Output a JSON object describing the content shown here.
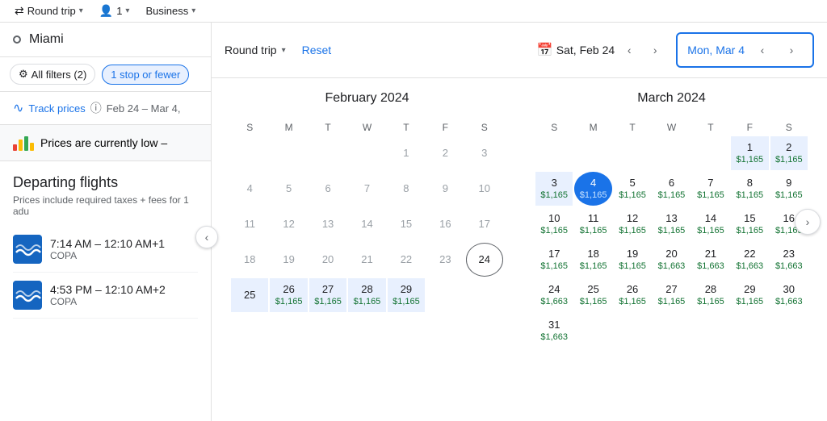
{
  "topBar": {
    "tripType": "Round trip",
    "passengers": "1",
    "cabinClass": "Business",
    "tripTypeChevron": "▾",
    "passengersChevron": "▾",
    "cabinChevron": "▾"
  },
  "leftPanel": {
    "searchCity": "Miami",
    "filters": {
      "allFilters": "All filters (2)",
      "stops": "1 stop or fewer"
    },
    "trackPrices": {
      "label": "Track prices",
      "dates": "Feb 24 – Mar 4,"
    },
    "pricesLow": "Prices are currently low –",
    "departingTitle": "Departing flights",
    "departingSub": "Prices include required taxes + fees for 1 adu",
    "flights": [
      {
        "time": "7:14 AM – 12:10 AM+1",
        "airline": "COPA"
      },
      {
        "time": "4:53 PM – 12:10 AM+2",
        "airline": "COPA"
      }
    ]
  },
  "calendarPanel": {
    "tripType": "Round trip",
    "resetLabel": "Reset",
    "departureDateLabel": "Sat, Feb 24",
    "returnDateLabel": "Mon, Mar 4",
    "calendarIcon": "📅",
    "february": {
      "title": "February 2024",
      "headers": [
        "S",
        "M",
        "T",
        "W",
        "T",
        "F",
        "S"
      ],
      "weeks": [
        [
          {
            "day": "",
            "price": "",
            "type": "empty"
          },
          {
            "day": "",
            "price": "",
            "type": "empty"
          },
          {
            "day": "",
            "price": "",
            "type": "empty"
          },
          {
            "day": "",
            "price": "",
            "type": "empty"
          },
          {
            "day": "1",
            "price": "",
            "type": "greyed"
          },
          {
            "day": "2",
            "price": "",
            "type": "greyed"
          },
          {
            "day": "3",
            "price": "",
            "type": "greyed"
          }
        ],
        [
          {
            "day": "4",
            "price": "",
            "type": "greyed"
          },
          {
            "day": "5",
            "price": "",
            "type": "greyed"
          },
          {
            "day": "6",
            "price": "",
            "type": "greyed"
          },
          {
            "day": "7",
            "price": "",
            "type": "greyed"
          },
          {
            "day": "8",
            "price": "",
            "type": "greyed"
          },
          {
            "day": "9",
            "price": "",
            "type": "greyed"
          },
          {
            "day": "10",
            "price": "",
            "type": "greyed"
          }
        ],
        [
          {
            "day": "11",
            "price": "",
            "type": "greyed"
          },
          {
            "day": "12",
            "price": "",
            "type": "greyed"
          },
          {
            "day": "13",
            "price": "",
            "type": "greyed"
          },
          {
            "day": "14",
            "price": "",
            "type": "greyed"
          },
          {
            "day": "15",
            "price": "",
            "type": "greyed"
          },
          {
            "day": "16",
            "price": "",
            "type": "greyed"
          },
          {
            "day": "17",
            "price": "",
            "type": "greyed"
          }
        ],
        [
          {
            "day": "18",
            "price": "",
            "type": "greyed"
          },
          {
            "day": "19",
            "price": "",
            "type": "greyed"
          },
          {
            "day": "20",
            "price": "",
            "type": "greyed"
          },
          {
            "day": "21",
            "price": "",
            "type": "greyed"
          },
          {
            "day": "22",
            "price": "",
            "type": "greyed"
          },
          {
            "day": "23",
            "price": "",
            "type": "greyed"
          },
          {
            "day": "24",
            "price": "",
            "type": "today-circle"
          }
        ],
        [
          {
            "day": "25",
            "price": "",
            "type": "in-range"
          },
          {
            "day": "26",
            "price": "$1,165",
            "type": "in-range"
          },
          {
            "day": "27",
            "price": "$1,165",
            "type": "in-range"
          },
          {
            "day": "28",
            "price": "$1,165",
            "type": "in-range"
          },
          {
            "day": "29",
            "price": "$1,165",
            "type": "in-range"
          },
          {
            "day": "",
            "price": "",
            "type": "empty"
          },
          {
            "day": "",
            "price": "",
            "type": "empty"
          }
        ]
      ]
    },
    "march": {
      "title": "March 2024",
      "headers": [
        "S",
        "M",
        "T",
        "W",
        "T",
        "F",
        "S"
      ],
      "weeks": [
        [
          {
            "day": "",
            "price": "",
            "type": "empty"
          },
          {
            "day": "",
            "price": "",
            "type": "empty"
          },
          {
            "day": "",
            "price": "",
            "type": "empty"
          },
          {
            "day": "",
            "price": "",
            "type": "empty"
          },
          {
            "day": "",
            "price": "",
            "type": "empty"
          },
          {
            "day": "1",
            "price": "$1,165",
            "type": "in-range"
          },
          {
            "day": "2",
            "price": "$1,165",
            "type": "in-range"
          }
        ],
        [
          {
            "day": "3",
            "price": "$1,165",
            "type": "in-range"
          },
          {
            "day": "4",
            "price": "$1,165",
            "type": "selected"
          },
          {
            "day": "5",
            "price": "$1,165",
            "type": "normal"
          },
          {
            "day": "6",
            "price": "$1,165",
            "type": "normal"
          },
          {
            "day": "7",
            "price": "$1,165",
            "type": "normal"
          },
          {
            "day": "8",
            "price": "$1,165",
            "type": "normal"
          },
          {
            "day": "9",
            "price": "$1,165",
            "type": "normal"
          }
        ],
        [
          {
            "day": "10",
            "price": "$1,165",
            "type": "normal"
          },
          {
            "day": "11",
            "price": "$1,165",
            "type": "normal"
          },
          {
            "day": "12",
            "price": "$1,165",
            "type": "normal"
          },
          {
            "day": "13",
            "price": "$1,165",
            "type": "normal"
          },
          {
            "day": "14",
            "price": "$1,165",
            "type": "normal"
          },
          {
            "day": "15",
            "price": "$1,165",
            "type": "normal"
          },
          {
            "day": "16",
            "price": "$1,165",
            "type": "normal"
          }
        ],
        [
          {
            "day": "17",
            "price": "$1,165",
            "type": "normal"
          },
          {
            "day": "18",
            "price": "$1,165",
            "type": "normal"
          },
          {
            "day": "19",
            "price": "$1,165",
            "type": "normal"
          },
          {
            "day": "20",
            "price": "$1,663",
            "type": "normal"
          },
          {
            "day": "21",
            "price": "$1,663",
            "type": "normal"
          },
          {
            "day": "22",
            "price": "$1,663",
            "type": "normal"
          },
          {
            "day": "23",
            "price": "$1,663",
            "type": "normal"
          }
        ],
        [
          {
            "day": "24",
            "price": "$1,663",
            "type": "normal"
          },
          {
            "day": "25",
            "price": "$1,165",
            "type": "normal"
          },
          {
            "day": "26",
            "price": "$1,165",
            "type": "normal"
          },
          {
            "day": "27",
            "price": "$1,165",
            "type": "normal"
          },
          {
            "day": "28",
            "price": "$1,165",
            "type": "normal"
          },
          {
            "day": "29",
            "price": "$1,165",
            "type": "normal"
          },
          {
            "day": "30",
            "price": "$1,663",
            "type": "normal"
          }
        ],
        [
          {
            "day": "31",
            "price": "$1,663",
            "type": "normal"
          },
          {
            "day": "",
            "price": "",
            "type": "empty"
          },
          {
            "day": "",
            "price": "",
            "type": "empty"
          },
          {
            "day": "",
            "price": "",
            "type": "empty"
          },
          {
            "day": "",
            "price": "",
            "type": "empty"
          },
          {
            "day": "",
            "price": "",
            "type": "empty"
          },
          {
            "day": "",
            "price": "",
            "type": "empty"
          }
        ]
      ]
    }
  },
  "icons": {
    "chevronLeft": "‹",
    "chevronRight": "›",
    "chevronDown": "▾",
    "collapse": "‹",
    "scrollRight": "›",
    "roundTrip": "⇄",
    "passengers": "👤",
    "trackPrices": "∿",
    "filter": "⚙"
  }
}
